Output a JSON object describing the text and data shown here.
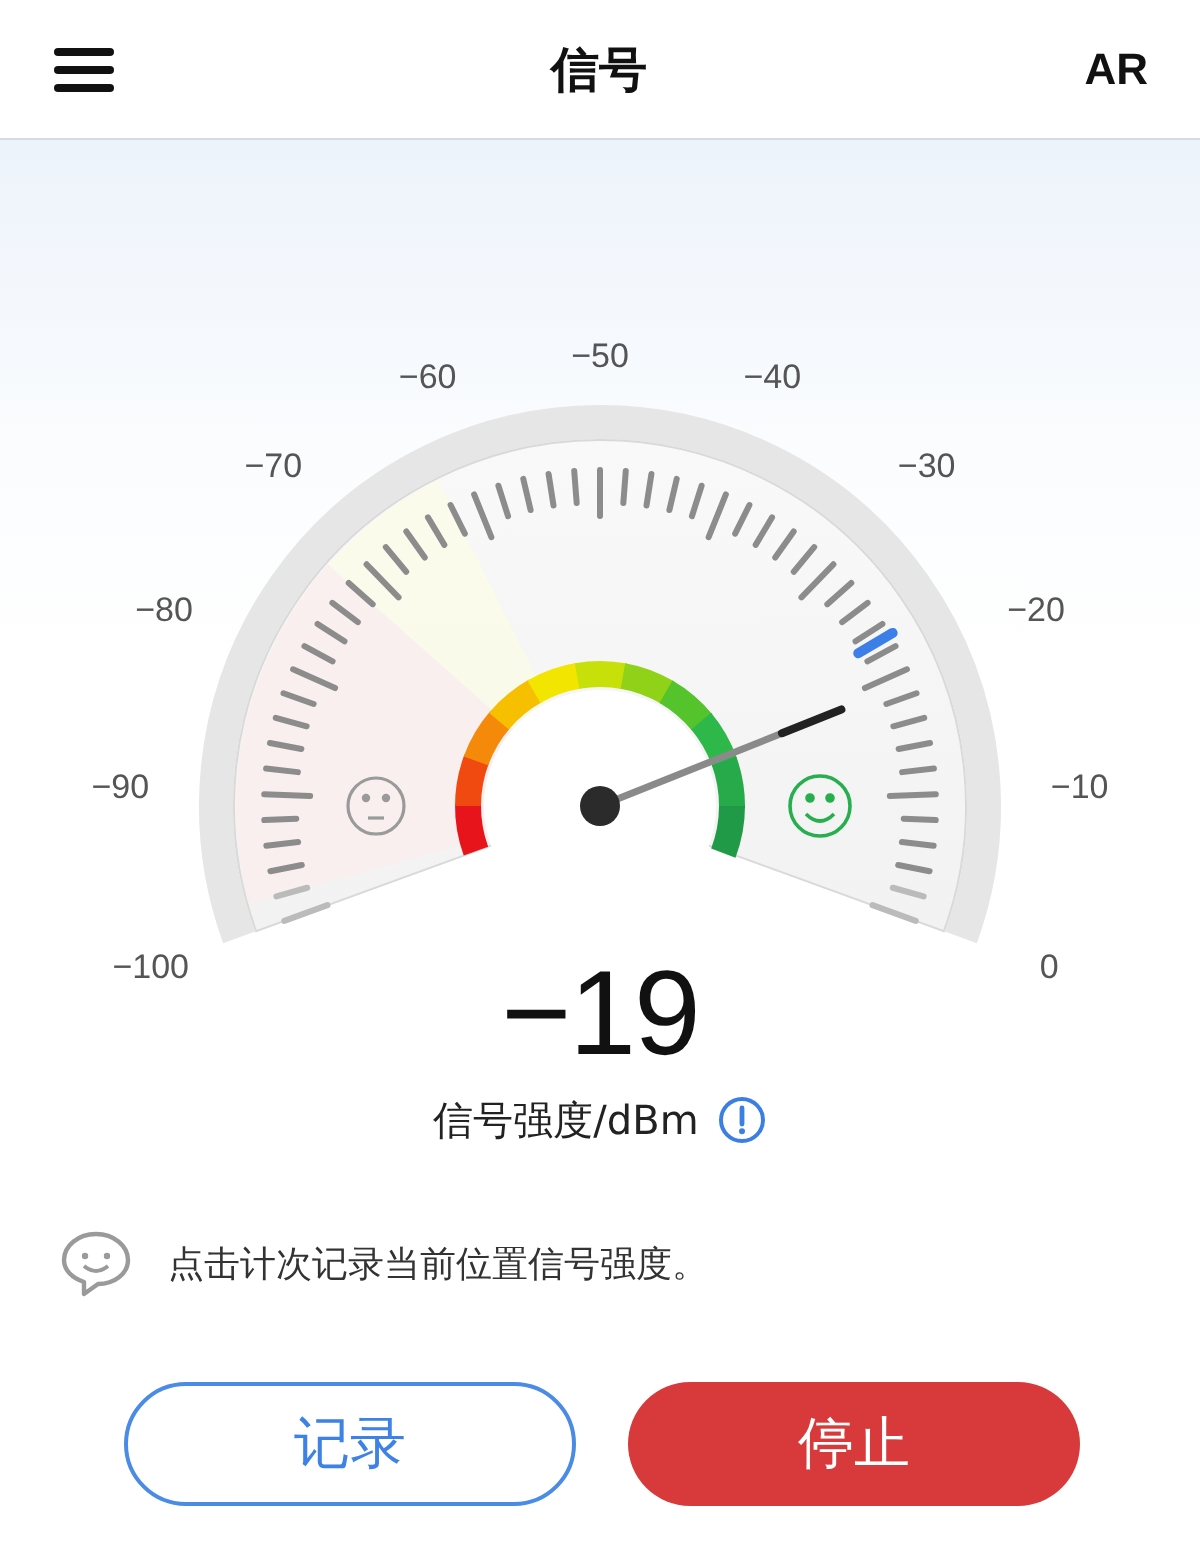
{
  "header": {
    "title": "信号",
    "action": "AR"
  },
  "gauge": {
    "scale_labels": [
      "−100",
      "−90",
      "−80",
      "−70",
      "−60",
      "−50",
      "−40",
      "−30",
      "−20",
      "−10",
      "0"
    ]
  },
  "reading": {
    "value": "−19",
    "unit_label": "信号强度/dBm"
  },
  "tip": "点击计次记录当前位置信号强度。",
  "buttons": [
    {
      "label": "记录",
      "kind": "outline"
    },
    {
      "label": "停止",
      "kind": "filled"
    }
  ]
}
